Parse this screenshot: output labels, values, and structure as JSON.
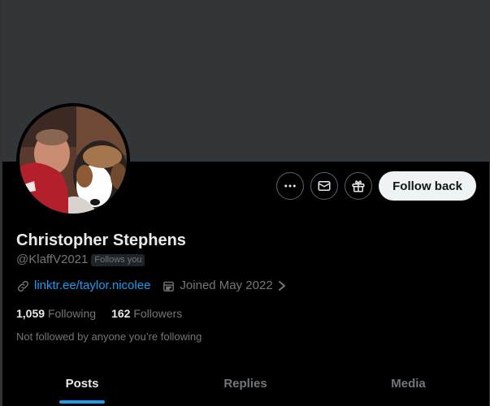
{
  "profile": {
    "name": "Christopher Stephens",
    "handle": "@KlaffV2021",
    "follows_you_badge": "Follows you",
    "website": "linktr.ee/taylor.nicolee",
    "joined": "Joined May 2022",
    "following_count": "1,059",
    "following_label": "Following",
    "followers_count": "162",
    "followers_label": "Followers",
    "mutual_note": "Not followed by anyone you’re following"
  },
  "actions": {
    "more_icon": "more-horizontal-icon",
    "message_icon": "envelope-icon",
    "gift_icon": "gift-icon",
    "follow_back_label": "Follow back"
  },
  "tabs": [
    {
      "label": "Posts",
      "active": true
    },
    {
      "label": "Replies",
      "active": false
    },
    {
      "label": "Media",
      "active": false
    }
  ],
  "colors": {
    "background": "#000000",
    "banner": "#333639",
    "accent": "#1d9bf0",
    "muted_text": "#71767b",
    "primary_text": "#e7e9ea",
    "follow_button": "#eff3f4"
  }
}
